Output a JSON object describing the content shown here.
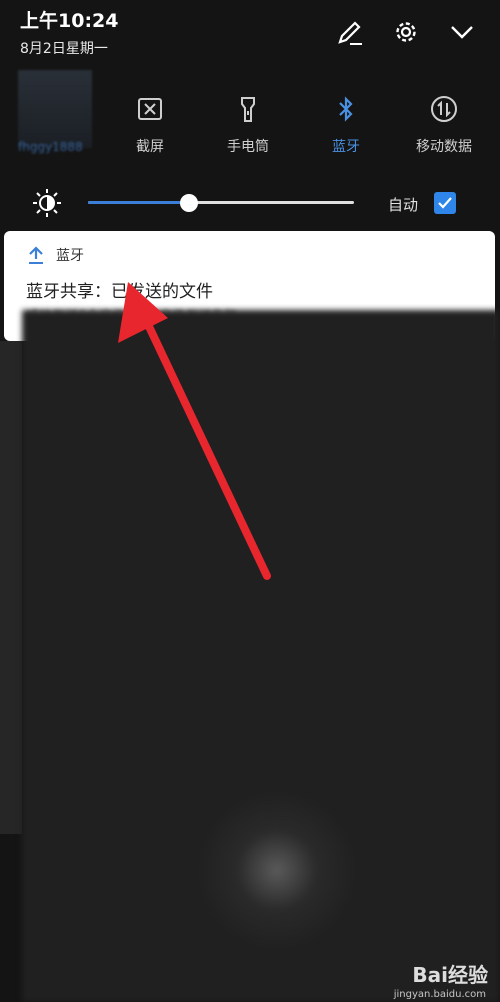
{
  "status": {
    "time": "上午10:24",
    "date": "8月2日星期一"
  },
  "quick_tiles": [
    {
      "label": "fhggy1888",
      "icon": "wifi-icon"
    },
    {
      "label": "截屏",
      "icon": "screenshot-icon"
    },
    {
      "label": "手电筒",
      "icon": "flashlight-icon"
    },
    {
      "label": "蓝牙",
      "icon": "bluetooth-icon",
      "active": true
    },
    {
      "label": "移动数据",
      "icon": "mobile-data-icon"
    }
  ],
  "brightness": {
    "auto_label": "自动",
    "auto_checked": true,
    "level": 0.38
  },
  "notification": {
    "app": "蓝牙",
    "title": "蓝牙共享：已发送的文件",
    "subtitle": "成功发送0个文件，0个文件发送失败。"
  },
  "watermark": {
    "brand": "Bai经验",
    "url": "jingyan.baidu.com"
  },
  "colors": {
    "accent": "#3b7fd8",
    "arrow": "#e8262e"
  }
}
